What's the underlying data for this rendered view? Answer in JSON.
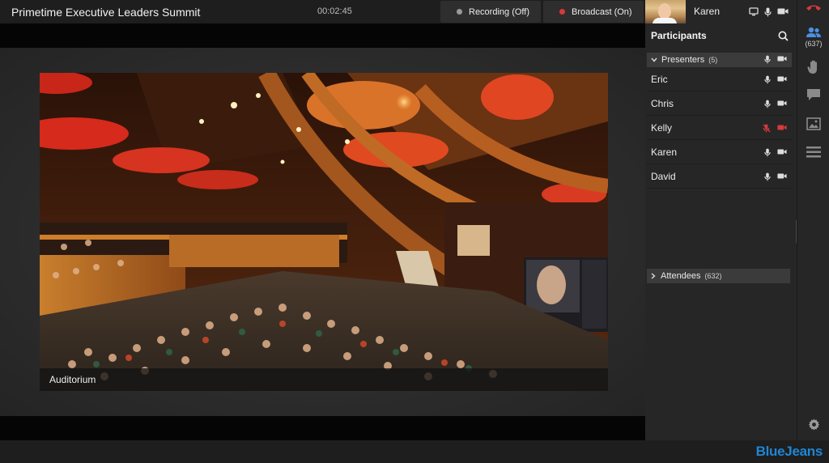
{
  "meeting": {
    "title": "Primetime Executive Leaders Summit",
    "elapsed": "00:02:45",
    "recording_label": "Recording (Off)",
    "broadcast_label": "Broadcast (On)"
  },
  "self": {
    "name": "Karen"
  },
  "participants_panel": {
    "title": "Participants",
    "presenters_label": "Presenters",
    "presenters_count": "(5)",
    "presenters": [
      {
        "name": "Eric",
        "muted": false
      },
      {
        "name": "Chris",
        "muted": false
      },
      {
        "name": "Kelly",
        "muted": true
      },
      {
        "name": "Karen",
        "muted": false
      },
      {
        "name": "David",
        "muted": false
      }
    ],
    "attendees_label": "Attendees",
    "attendees_count": "(632)"
  },
  "rail": {
    "participants_count": "(637)"
  },
  "video": {
    "caption": "Auditorium"
  },
  "brand": {
    "name": "BlueJeans"
  },
  "colors": {
    "brand": "#1f86d6",
    "alert": "#d9393a",
    "rail_active": "#4a90e2"
  }
}
